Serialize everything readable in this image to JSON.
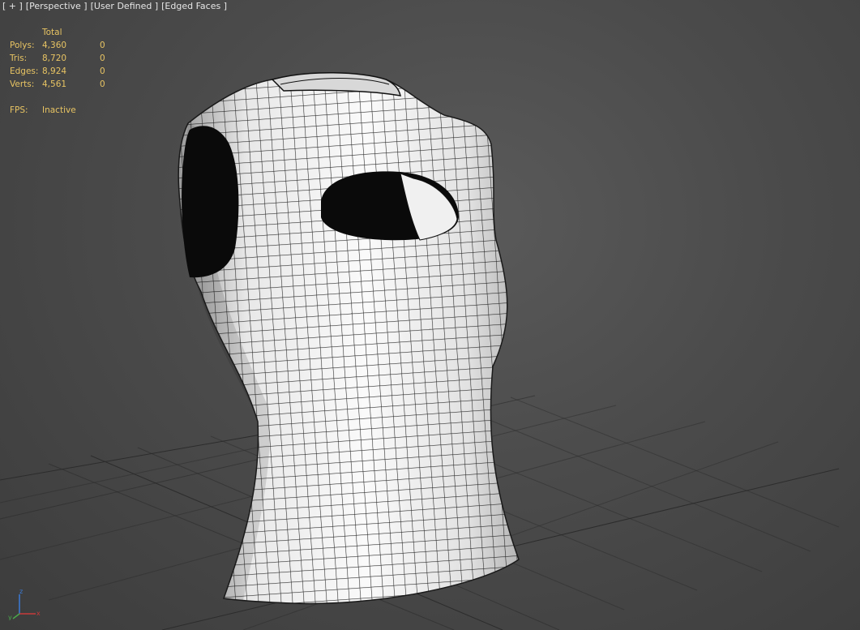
{
  "viewport_labels": {
    "menu": "[ + ]",
    "view": "[Perspective ]",
    "shading": "[User Defined ]",
    "edges": "[Edged Faces ]"
  },
  "stats": {
    "header": "Total",
    "rows": [
      {
        "label": "Polys:",
        "total": "4,360",
        "selected": "0"
      },
      {
        "label": "Tris:",
        "total": "8,720",
        "selected": "0"
      },
      {
        "label": "Edges:",
        "total": "8,924",
        "selected": "0"
      },
      {
        "label": "Verts:",
        "total": "4,561",
        "selected": "0"
      }
    ],
    "fps_label": "FPS:",
    "fps_value": "Inactive"
  },
  "axis": {
    "x": "x",
    "y": "y",
    "z": "z"
  },
  "colors": {
    "stats_text": "#e8c463",
    "label_text": "#e6e6e6",
    "grid": "#2a2a2a",
    "mesh_fill": "#f2f2f2",
    "wire": "#111111"
  }
}
